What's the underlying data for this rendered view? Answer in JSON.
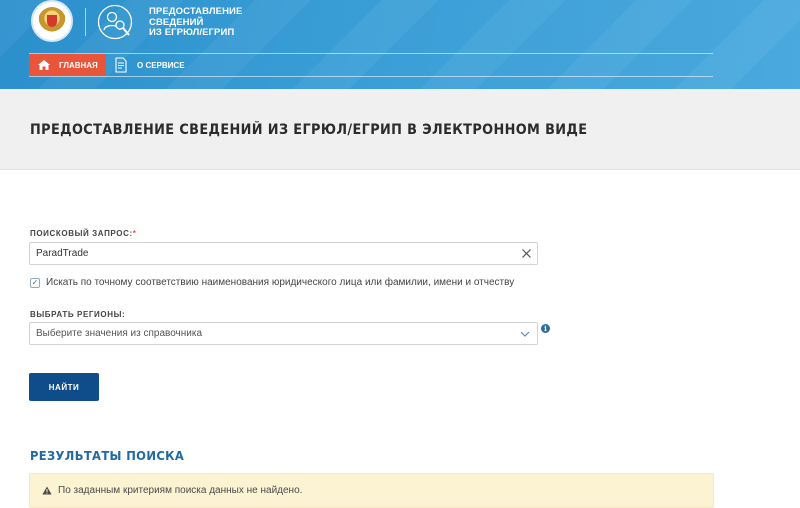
{
  "header": {
    "service_title_lines": [
      "ПРЕДОСТАВЛЕНИЕ",
      "СВЕДЕНИЙ",
      "ИЗ ЕГРЮЛ/ЕГРИП"
    ],
    "nav": {
      "home_label": "ГЛАВНАЯ",
      "about_label": "О СЕРВИСЕ"
    }
  },
  "page": {
    "title": "ПРЕДОСТАВЛЕНИЕ СВЕДЕНИЙ ИЗ ЕГРЮЛ/ЕГРИП В ЭЛЕКТРОННОМ ВИДЕ"
  },
  "form": {
    "query_label": "ПОИСКОВЫЙ ЗАПРОС:",
    "required_mark": "*",
    "query_value": "ParadTrade",
    "exact_match_checked": true,
    "exact_match_label": "Искать по точному соответствию наименования юридического лица или фамилии, имени и отчеству",
    "regions_label": "ВЫБРАТЬ РЕГИОНЫ:",
    "regions_placeholder": "Выберите значения из справочника",
    "info_symbol": "i",
    "search_button": "НАЙТИ"
  },
  "results": {
    "title": "РЕЗУЛЬТАТЫ ПОИСКА",
    "message": "По заданным критериям поиска данных не найдено."
  },
  "colors": {
    "header_blue": "#3a9ed6",
    "nav_active": "#e8553a",
    "button_blue": "#0f4c8a",
    "results_title": "#1f6aa5",
    "alert_bg": "#fcf3d2"
  }
}
